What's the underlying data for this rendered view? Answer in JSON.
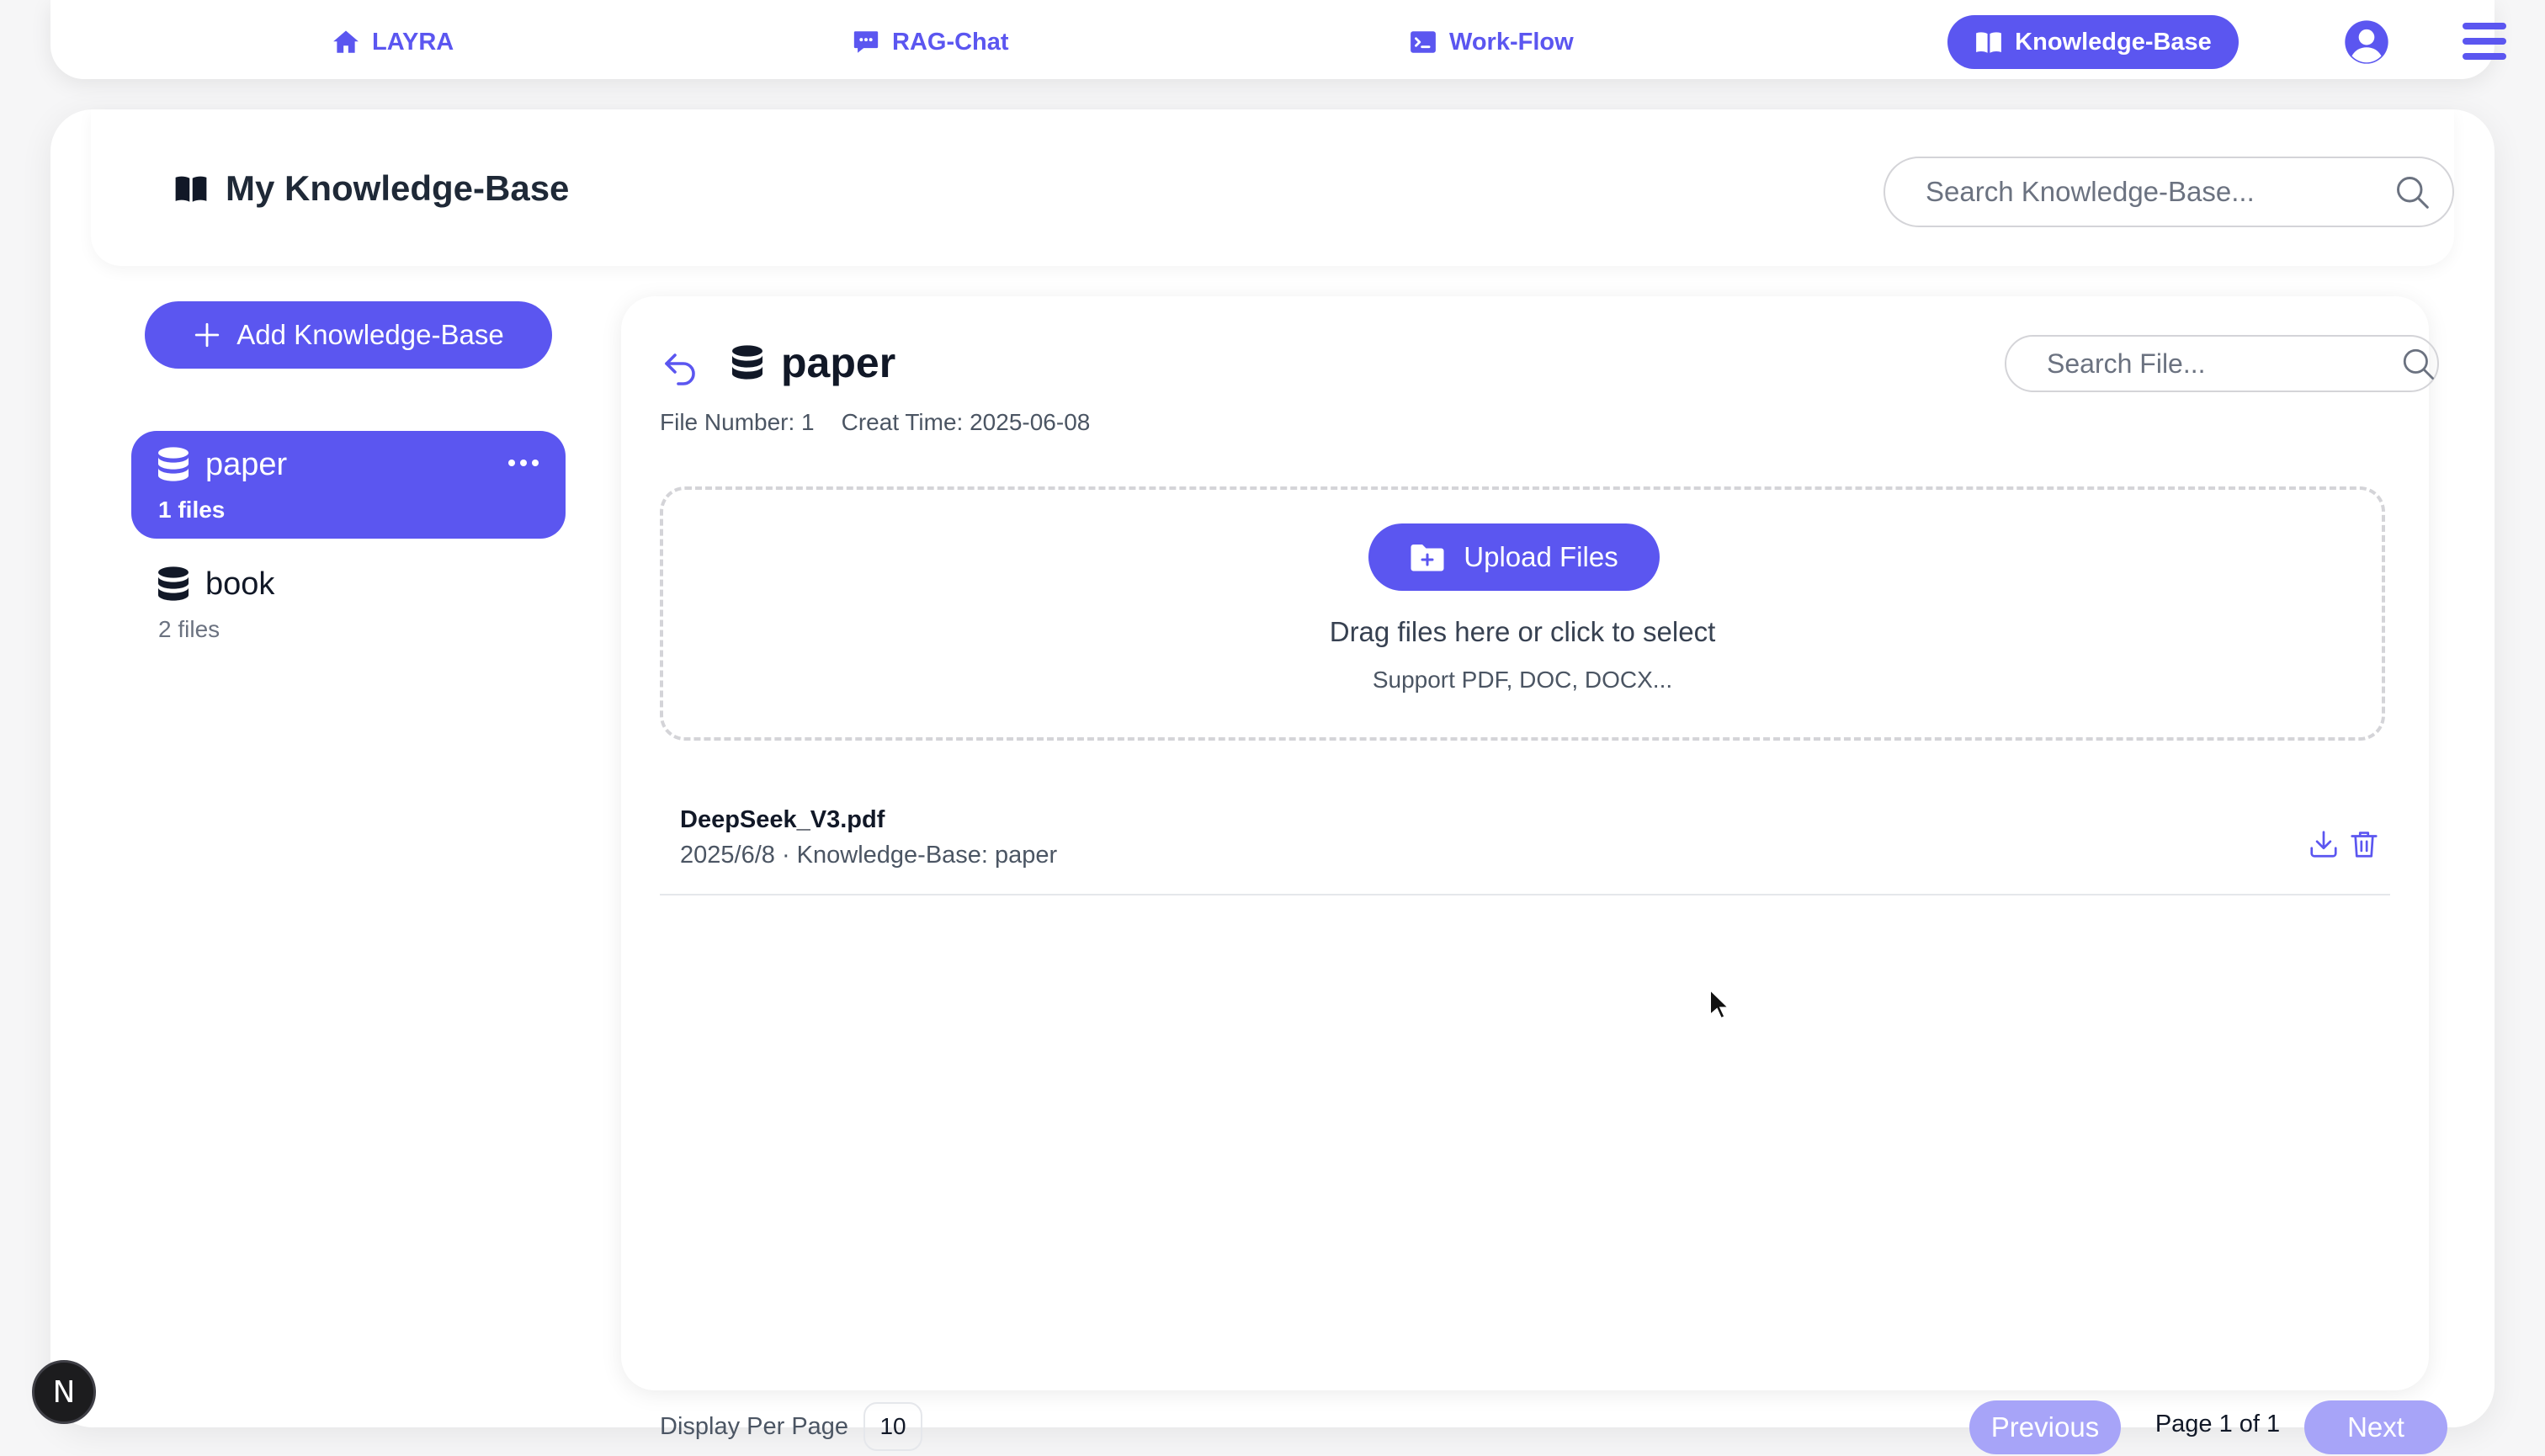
{
  "nav": {
    "items": [
      {
        "label": "LAYRA",
        "icon": "home-icon"
      },
      {
        "label": "RAG-Chat",
        "icon": "chat-icon"
      },
      {
        "label": "Work-Flow",
        "icon": "terminal-icon"
      },
      {
        "label": "Knowledge-Base",
        "icon": "book-icon",
        "active": true
      }
    ],
    "user_icon": "user-circle-icon",
    "menu_icon": "hamburger-icon"
  },
  "header": {
    "title": "My Knowledge-Base",
    "search_placeholder": "Search Knowledge-Base..."
  },
  "sidebar": {
    "add_button_label": "Add Knowledge-Base",
    "knowledge_bases": [
      {
        "name": "paper",
        "count_label": "1 files",
        "active": true
      },
      {
        "name": "book",
        "count_label": "2 files",
        "active": false
      }
    ]
  },
  "content": {
    "kb_name": "paper",
    "file_search_placeholder": "Search File...",
    "file_number_label": "File Number: 1",
    "create_time_label": "Creat Time: 2025-06-08",
    "upload": {
      "button_label": "Upload Files",
      "drag_text": "Drag files here or click to select",
      "support_text": "Support PDF, DOC, DOCX..."
    },
    "files": [
      {
        "name": "DeepSeek_V3.pdf",
        "meta": "2025/6/8 · Knowledge-Base: paper"
      }
    ],
    "pagination": {
      "per_page_label": "Display Per Page",
      "per_page_value": "10",
      "previous_label": "Previous",
      "page_label": "Page 1 of 1",
      "next_label": "Next"
    }
  },
  "dev_badge": "N",
  "colors": {
    "accent": "#5b56f0",
    "accent_disabled": "#a7a4f8",
    "background": "#f6f6f7"
  }
}
